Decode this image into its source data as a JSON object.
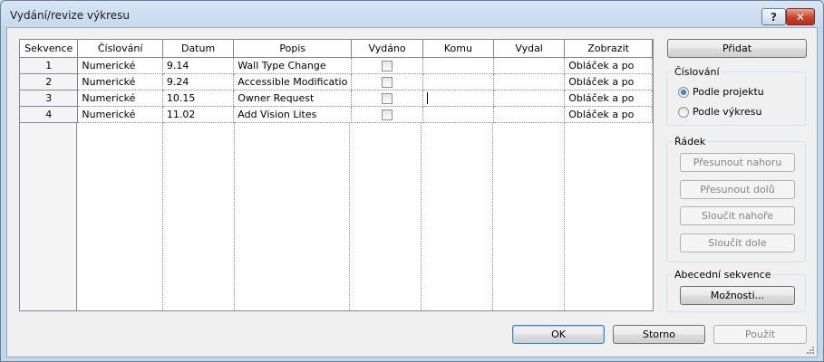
{
  "window": {
    "title": "Vydání/revize výkresu",
    "help_label": "?",
    "close_label": "✕"
  },
  "grid": {
    "headers": [
      "Sekvence",
      "Číslování",
      "Datum",
      "Popis",
      "Vydáno",
      "Komu",
      "Vydal",
      "Zobrazit"
    ],
    "rows": [
      {
        "seq": "1",
        "numbering": "Numerické",
        "date": "9.14",
        "desc": "Wall Type Change",
        "issued": false,
        "to": "",
        "by": "",
        "show": "Obláček a po"
      },
      {
        "seq": "2",
        "numbering": "Numerické",
        "date": "9.24",
        "desc": "Accessible Modificatio",
        "issued": false,
        "to": "",
        "by": "",
        "show": "Obláček a po"
      },
      {
        "seq": "3",
        "numbering": "Numerické",
        "date": "10.15",
        "desc": "Owner Request",
        "issued": false,
        "to": "",
        "by": "",
        "show": "Obláček a po"
      },
      {
        "seq": "4",
        "numbering": "Numerické",
        "date": "11.02",
        "desc": "Add Vision Lites",
        "issued": false,
        "to": "",
        "by": "",
        "show": "Obláček a po"
      }
    ]
  },
  "side": {
    "add_label": "Přidat",
    "numbering_group": "Číslování",
    "radio_project": "Podle projektu",
    "radio_sheet": "Podle výkresu",
    "row_group": "Řádek",
    "move_up": "Přesunout nahoru",
    "move_down": "Přesunout dolů",
    "merge_up": "Sloučit nahoře",
    "merge_down": "Sloučit dole",
    "alpha_group": "Abecední sekvence",
    "options": "Možnosti..."
  },
  "footer": {
    "ok": "OK",
    "cancel": "Storno",
    "apply": "Použít"
  },
  "colors": {
    "accent": "#3c7fb1",
    "close": "#c7432b"
  }
}
